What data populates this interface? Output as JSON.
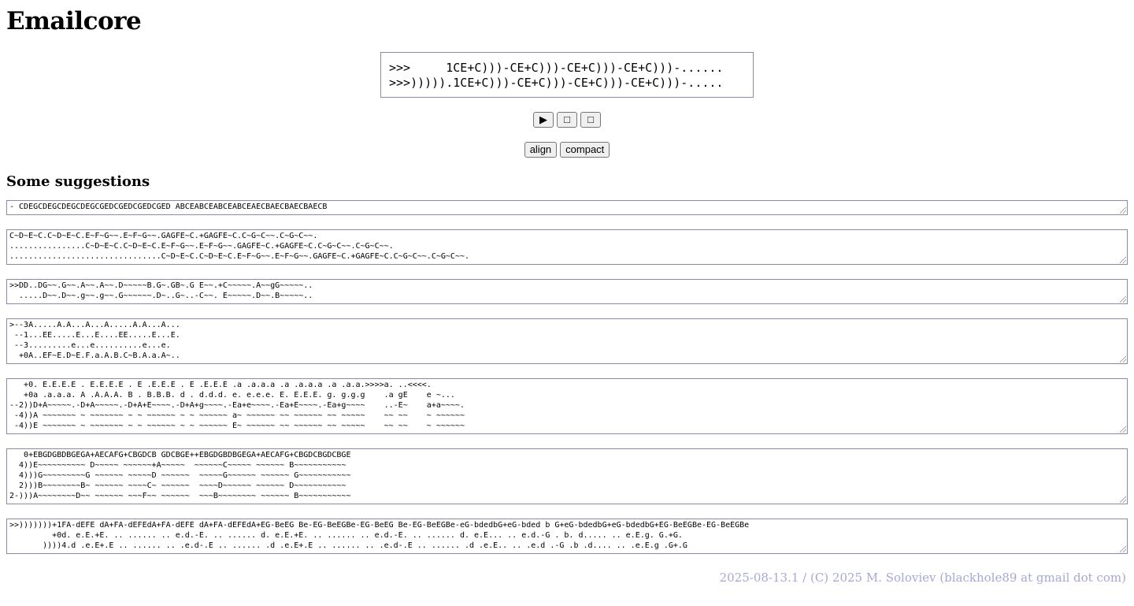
{
  "title": "Emailcore",
  "preview": {
    "line1": ">>>     1CE+C)))-CE+C)))-CE+C)))-CE+C)))-......",
    "line2": ">>>))))).1CE+C)))-CE+C)))-CE+C)))-CE+C)))-....."
  },
  "controls": {
    "play_label": "▶",
    "stop_label": "□",
    "loop_label": "□"
  },
  "modes": {
    "align_label": "align",
    "compact_label": "compact"
  },
  "suggestions_heading": "Some suggestions",
  "suggestions": [
    "- CDEGCDEGCDEGCDEGCGEDCGEDCGEDCGED ABCEABCEABCEABCEAECBAECBAECBAECB",
    "C~D~E~C.C~D~E~C.E~F~G~~.E~F~G~~.GAGFE~C.+GAGFE~C.C~G~C~~.C~G~C~~.\n................C~D~E~C.C~D~E~C.E~F~G~~.E~F~G~~.GAGFE~C.+GAGFE~C.C~G~C~~.C~G~C~~.\n................................C~D~E~C.C~D~E~C.E~F~G~~.E~F~G~~.GAGFE~C.+GAGFE~C.C~G~C~~.C~G~C~~.",
    ">>DD..DG~~.G~~.A~~.A~~.D~~~~~B.G~.GB~.G E~~.+C~~~~~.A~~gG~~~~~..\n  .....D~~.D~~.g~~.g~~.G~~~~~~.D~..G~..-C~~. E~~~~~.D~~.B~~~~~..",
    ">--3A.....A.A...A...A.....A.A...A...\n --1...EE.....E...E....EE.....E...E.\n --3.........e...e..........e...e.\n  +0A..EF~E.D~E.F.a.A.B.C~B.A.a.A~..",
    "   +0. E.E.E.E . E.E.E.E . E .E.E.E . E .E.E.E .a .a.a.a .a .a.a.a .a .a.a.>>>>a. ..<<<<.\n   +0a .a.a.a. A .A.A.A. B . B.B.B. d . d.d.d. e. e.e.e. E. E.E.E. g. g.g.g    .a gE    e ~...\n--2))D+A~~~~~.-D+A~~~~~.-D+A+E~~~~.-D+A+g~~~~.-Ea+e~~~~.-Ea+E~~~~.-Ea+g~~~~    ..-E~    a+a~~~~.\n -4))A ~~~~~~~ ~ ~~~~~~~ ~ ~ ~~~~~~ ~ ~ ~~~~~~ a~ ~~~~~~ ~~ ~~~~~~ ~~ ~~~~~    ~~ ~~    ~ ~~~~~~\n -4))E ~~~~~~~ ~ ~~~~~~~ ~ ~ ~~~~~~ ~ ~ ~~~~~~ E~ ~~~~~~ ~~ ~~~~~~ ~~ ~~~~~    ~~ ~~    ~ ~~~~~~",
    "   0+EBGDGBDBGEGA+AECAFG+CBGDCB GDCBGE++EBGDGBDBGEGA+AECAFG+CBGDCBGDCBGE\n  4))E~~~~~~~~~~ D~~~~~ ~~~~~~+A~~~~~  ~~~~~~C~~~~~ ~~~~~~ B~~~~~~~~~~~\n  4)))G~~~~~~~~~G ~~~~~~ ~~~~~D ~~~~~~  ~~~~~G~~~~~~ ~~~~~~ G~~~~~~~~~~~\n  2)))B~~~~~~~~B~ ~~~~~~ ~~~~C~ ~~~~~~  ~~~~D~~~~~~ ~~~~~~ D~~~~~~~~~~~\n2-)))A~~~~~~~~D~~ ~~~~~~ ~~~F~~ ~~~~~~  ~~~B~~~~~~~~ ~~~~~~ B~~~~~~~~~~~",
    ">>)))))))+1FA-dEFE dA+FA-dEFEdA+FA-dEFE dA+FA-dEFEdA+EG-BeEG Be-EG-BeEGBe-EG-BeEG Be-EG-BeEGBe-eG-bdedbG+eG-bded b G+eG-bdedbG+eG-bdedbG+EG-BeEGBe-EG-BeEGBe\n         +0d. e.E.+E. .. ...... .. e.d.-E. .. ...... d. e.E.+E. .. ...... .. e.d.-E. .. ...... d. e.E... .. e.d.-G . b. d..... .. e.E.g. G.+G.\n       ))))4.d .e.E+.E .. ...... .. .e.d-.E .. ...... .d .e.E+.E .. ...... .. .e.d-.E .. ...... .d .e.E.. .. .e.d .-G .b .d.... .. .e.E.g .G+.G"
  ],
  "footer": "2025-08-13.1 / (C) 2025 M. Soloviev (blackhole89 at gmail dot com)"
}
